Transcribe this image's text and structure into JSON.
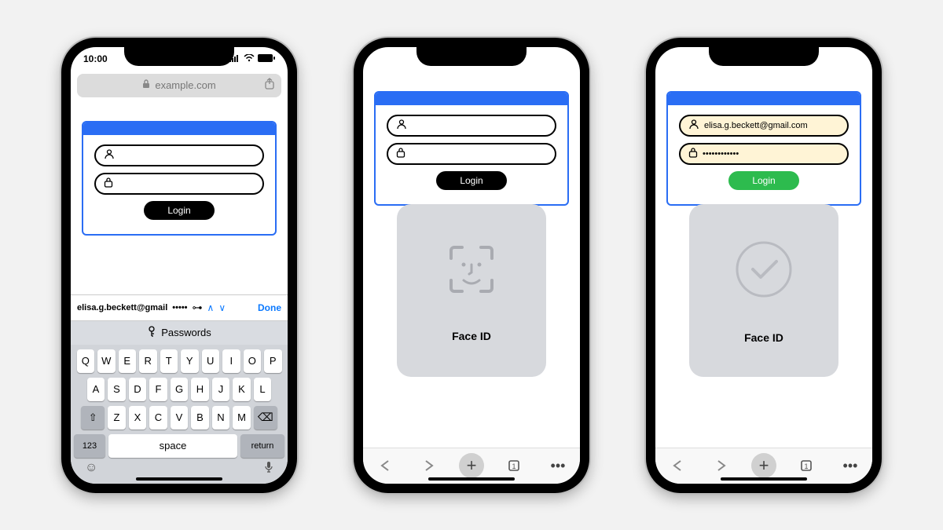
{
  "status": {
    "time": "10:00",
    "signal_icon": "signal",
    "wifi_icon": "wifi",
    "battery_icon": "battery"
  },
  "browser": {
    "url": "example.com",
    "share_icon": "share"
  },
  "card": {
    "user_icon": "person",
    "lock_icon": "lock",
    "login_label": "Login",
    "username_value_empty": "",
    "password_value_empty": "",
    "username_value_filled": "elisa.g.beckett@gmail.com",
    "password_value_filled": "••••••••••••"
  },
  "kbd": {
    "suggestion_user": "elisa.g.beckett@gmail",
    "suggestion_pw": "•••••",
    "done": "Done",
    "passwords_label": "Passwords",
    "row1": [
      "Q",
      "W",
      "E",
      "R",
      "T",
      "Y",
      "U",
      "I",
      "O",
      "P"
    ],
    "row2": [
      "A",
      "S",
      "D",
      "F",
      "G",
      "H",
      "J",
      "K",
      "L"
    ],
    "row3": [
      "Z",
      "X",
      "C",
      "V",
      "B",
      "N",
      "M"
    ],
    "num_label": "123",
    "space_label": "space",
    "return_label": "return"
  },
  "faceid": {
    "label": "Face ID"
  },
  "nav": {
    "back_icon": "arrow-left",
    "forward_icon": "arrow-right",
    "plus_icon": "plus",
    "tabs_icon": "tabs",
    "more_icon": "more"
  }
}
